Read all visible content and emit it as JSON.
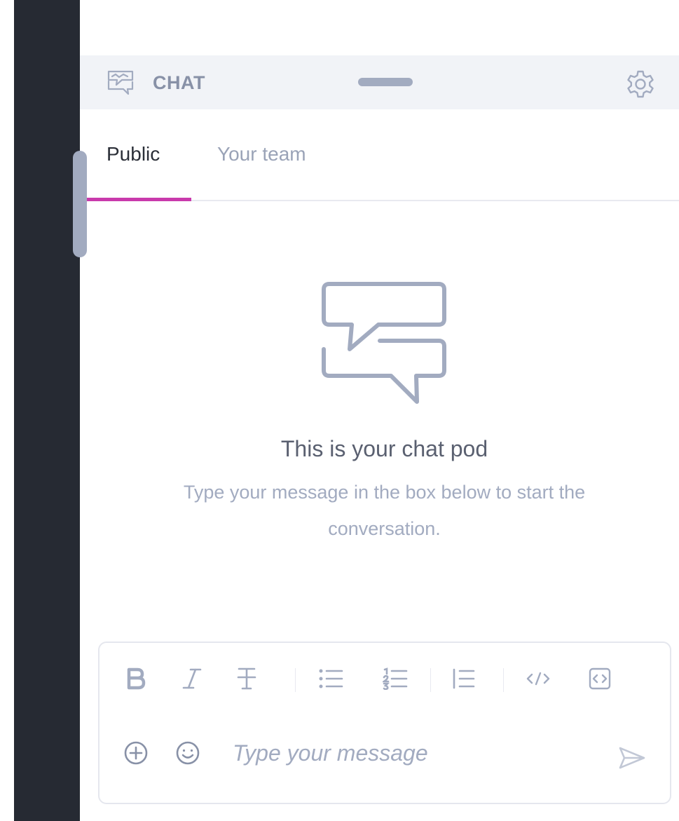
{
  "header": {
    "title": "CHAT",
    "icons": {
      "chat": "chat-bubbles-icon",
      "settings": "gear-icon"
    }
  },
  "tabs": [
    {
      "label": "Public",
      "active": true
    },
    {
      "label": "Your team",
      "active": false
    }
  ],
  "empty_state": {
    "icon": "chat-bubbles-icon",
    "title": "This is your chat pod",
    "subtitle": "Type your message in the box below to start the conversation."
  },
  "composer": {
    "placeholder": "Type your message",
    "toolbar": [
      "bold-icon",
      "italic-icon",
      "strikethrough-icon",
      "bullet-list-icon",
      "numbered-list-icon",
      "blockquote-icon",
      "code-icon",
      "code-block-icon"
    ],
    "actions": [
      "plus-circle-icon",
      "emoji-icon",
      "send-icon"
    ]
  },
  "colors": {
    "rail": "#262a33",
    "accent": "#c93aac",
    "header_bg": "#f1f3f7",
    "muted": "#a2abc0",
    "text_dark": "#2b2f38"
  }
}
